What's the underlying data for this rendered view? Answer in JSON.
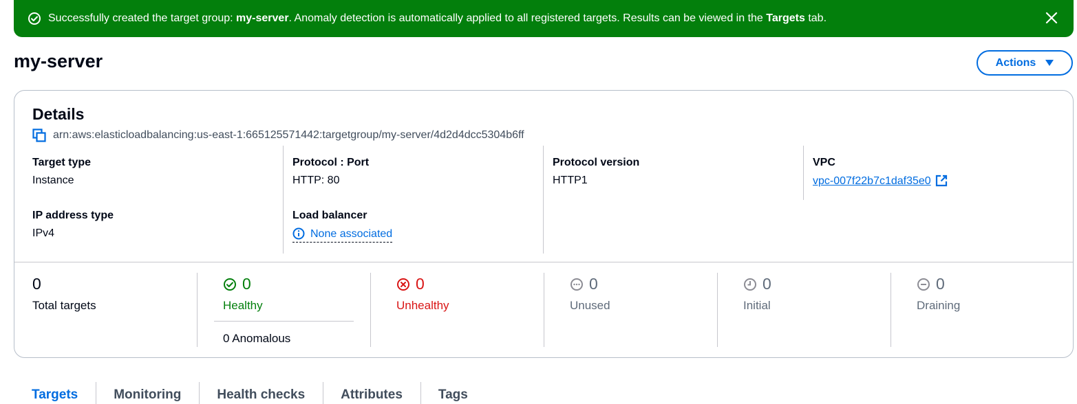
{
  "flash": {
    "prefix": "Successfully created the target group: ",
    "group_name": "my-server",
    "middle": ". Anomaly detection is automatically applied to all registered targets. Results can be viewed in the ",
    "tab_name": "Targets",
    "suffix": " tab.",
    "color": "#037f0c"
  },
  "header": {
    "title": "my-server",
    "actions_label": "Actions"
  },
  "details": {
    "title": "Details",
    "arn": "arn:aws:elasticloadbalancing:us-east-1:665125571442:targetgroup/my-server/4d2d4dcc5304b6ff",
    "target_type": {
      "label": "Target type",
      "value": "Instance"
    },
    "protocol_port": {
      "label": "Protocol : Port",
      "value": "HTTP: 80"
    },
    "protocol_version": {
      "label": "Protocol version",
      "value": "HTTP1"
    },
    "vpc": {
      "label": "VPC",
      "value": "vpc-007f22b7c1daf35e0"
    },
    "ip_address_type": {
      "label": "IP address type",
      "value": "IPv4"
    },
    "load_balancer": {
      "label": "Load balancer",
      "value": "None associated"
    }
  },
  "stats": {
    "total": {
      "value": "0",
      "label": "Total targets"
    },
    "healthy": {
      "value": "0",
      "label": "Healthy",
      "anomalous": "0 Anomalous"
    },
    "unhealthy": {
      "value": "0",
      "label": "Unhealthy"
    },
    "unused": {
      "value": "0",
      "label": "Unused"
    },
    "initial": {
      "value": "0",
      "label": "Initial"
    },
    "draining": {
      "value": "0",
      "label": "Draining"
    }
  },
  "tabs": [
    {
      "label": "Targets",
      "active": true
    },
    {
      "label": "Monitoring"
    },
    {
      "label": "Health checks"
    },
    {
      "label": "Attributes"
    },
    {
      "label": "Tags"
    }
  ],
  "colors": {
    "accent": "#006ce0",
    "success": "#037f0c",
    "error": "#d91515",
    "muted": "#5f6b7a"
  }
}
